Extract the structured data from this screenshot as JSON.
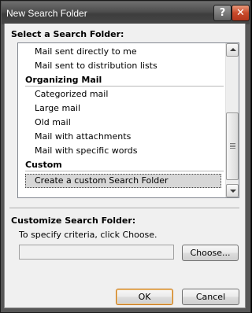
{
  "window": {
    "title": "New Search Folder"
  },
  "titlebar": {
    "help_glyph": "?",
    "close_glyph": "✕"
  },
  "select_section": {
    "label": "Select a Search Folder:"
  },
  "list": {
    "top_items": [
      "Mail sent directly to me",
      "Mail sent to distribution lists"
    ],
    "groups": [
      {
        "name": "Organizing Mail",
        "items": [
          "Categorized mail",
          "Large mail",
          "Old mail",
          "Mail with attachments",
          "Mail with specific words"
        ]
      },
      {
        "name": "Custom",
        "items": [
          "Create a custom Search Folder"
        ]
      }
    ],
    "selected_item": "Create a custom Search Folder"
  },
  "customize_section": {
    "label": "Customize Search Folder:",
    "instruction": "To specify criteria, click Choose.",
    "criteria_value": "",
    "choose_label": "Choose..."
  },
  "footer": {
    "ok_label": "OK",
    "cancel_label": "Cancel"
  },
  "colors": {
    "selection_bg": "#d7d7d7",
    "default_button_border": "#c4751a",
    "close_button": "#c8492a"
  },
  "icons": [
    "help-icon",
    "close-icon",
    "scroll-up-arrow-icon",
    "scroll-down-arrow-icon",
    "scroll-grip-icon"
  ]
}
